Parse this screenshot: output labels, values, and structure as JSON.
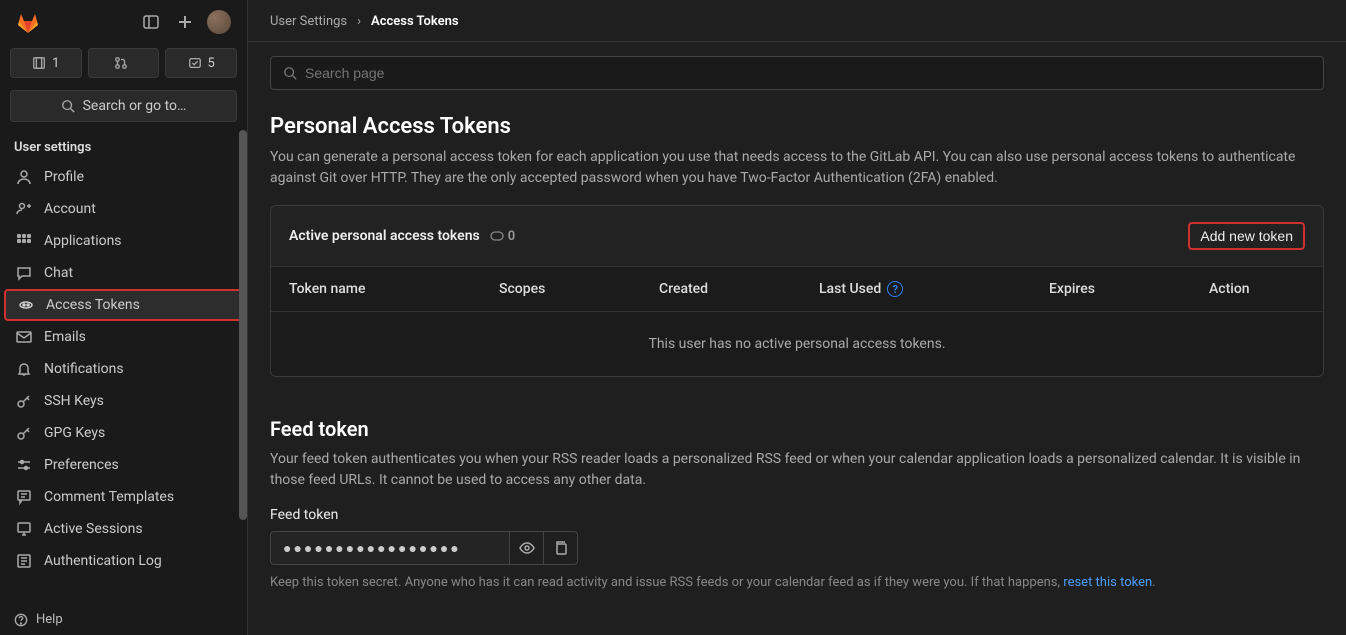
{
  "sidebar": {
    "counters": {
      "issues": "1",
      "mrs": "",
      "todos": "5"
    },
    "search_label": "Search or go to…",
    "section": "User settings",
    "items": [
      {
        "label": "Profile"
      },
      {
        "label": "Account"
      },
      {
        "label": "Applications"
      },
      {
        "label": "Chat"
      },
      {
        "label": "Access Tokens"
      },
      {
        "label": "Emails"
      },
      {
        "label": "Notifications"
      },
      {
        "label": "SSH Keys"
      },
      {
        "label": "GPG Keys"
      },
      {
        "label": "Preferences"
      },
      {
        "label": "Comment Templates"
      },
      {
        "label": "Active Sessions"
      },
      {
        "label": "Authentication Log"
      }
    ],
    "help": "Help"
  },
  "breadcrumb": {
    "parent": "User Settings",
    "sep": "›",
    "current": "Access Tokens"
  },
  "search_page_placeholder": "Search page",
  "section1": {
    "title": "Personal Access Tokens",
    "desc": "You can generate a personal access token for each application you use that needs access to the GitLab API. You can also use personal access tokens to authenticate against Git over HTTP. They are the only accepted password when you have Two-Factor Authentication (2FA) enabled.",
    "card_title": "Active personal access tokens",
    "count": "0",
    "add_btn": "Add new token",
    "columns": {
      "name": "Token name",
      "scopes": "Scopes",
      "created": "Created",
      "last_used": "Last Used",
      "expires": "Expires",
      "action": "Action"
    },
    "empty": "This user has no active personal access tokens."
  },
  "section2": {
    "title": "Feed token",
    "desc": "Your feed token authenticates you when your RSS reader loads a personalized RSS feed or when your calendar application loads a personalized calendar. It is visible in those feed URLs. It cannot be used to access any other data.",
    "label": "Feed token",
    "masked": "●●●●●●●●●●●●●●●●●",
    "hint_pre": "Keep this token secret. Anyone who has it can read activity and issue RSS feeds or your calendar feed as if they were you. If that happens, ",
    "hint_link": "reset this token",
    "hint_post": "."
  }
}
